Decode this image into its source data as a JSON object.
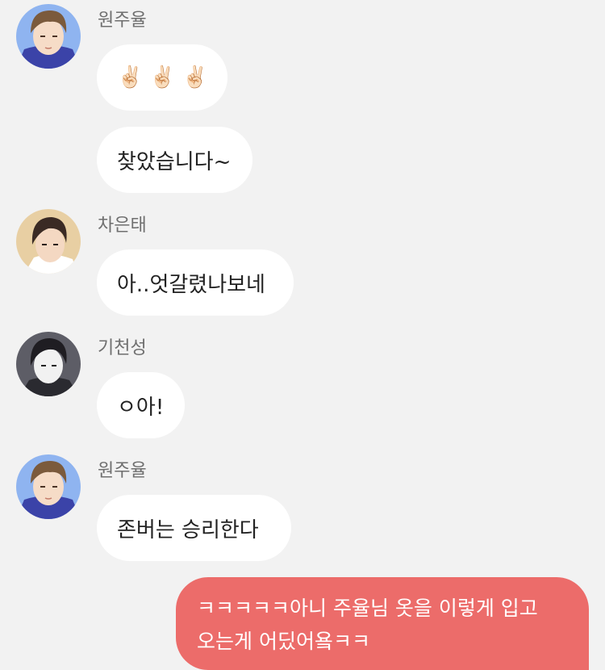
{
  "messages": [
    {
      "sender": "원주율",
      "avatar_icon": "avatar-wonjuyul-icon",
      "bubbles": [
        {
          "emojis": [
            "✌🏻",
            "✌🏻",
            "✌🏻"
          ]
        },
        {
          "text": "찾았습니다~"
        }
      ]
    },
    {
      "sender": "차은태",
      "avatar_icon": "avatar-chaeuntae-icon",
      "bubbles": [
        {
          "text": "아..엇갈렸나보네"
        }
      ]
    },
    {
      "sender": "기천성",
      "avatar_icon": "avatar-gicheonseong-icon",
      "bubbles": [
        {
          "text": "ㅇ아!"
        }
      ]
    },
    {
      "sender": "원주율",
      "avatar_icon": "avatar-wonjuyul-icon",
      "bubbles": [
        {
          "text": "존버는 승리한다"
        }
      ]
    }
  ],
  "my_message": {
    "line1": "ㅋㅋㅋㅋㅋ아니 주율님 옷을 이렇게 입고",
    "line2": "오는게 어딨어욬ㅋㅋ"
  },
  "colors": {
    "background": "#f2f2f2",
    "incoming_bubble": "#ffffff",
    "outgoing_bubble": "#ec6c6a",
    "sender_name": "#6f6f6f"
  }
}
